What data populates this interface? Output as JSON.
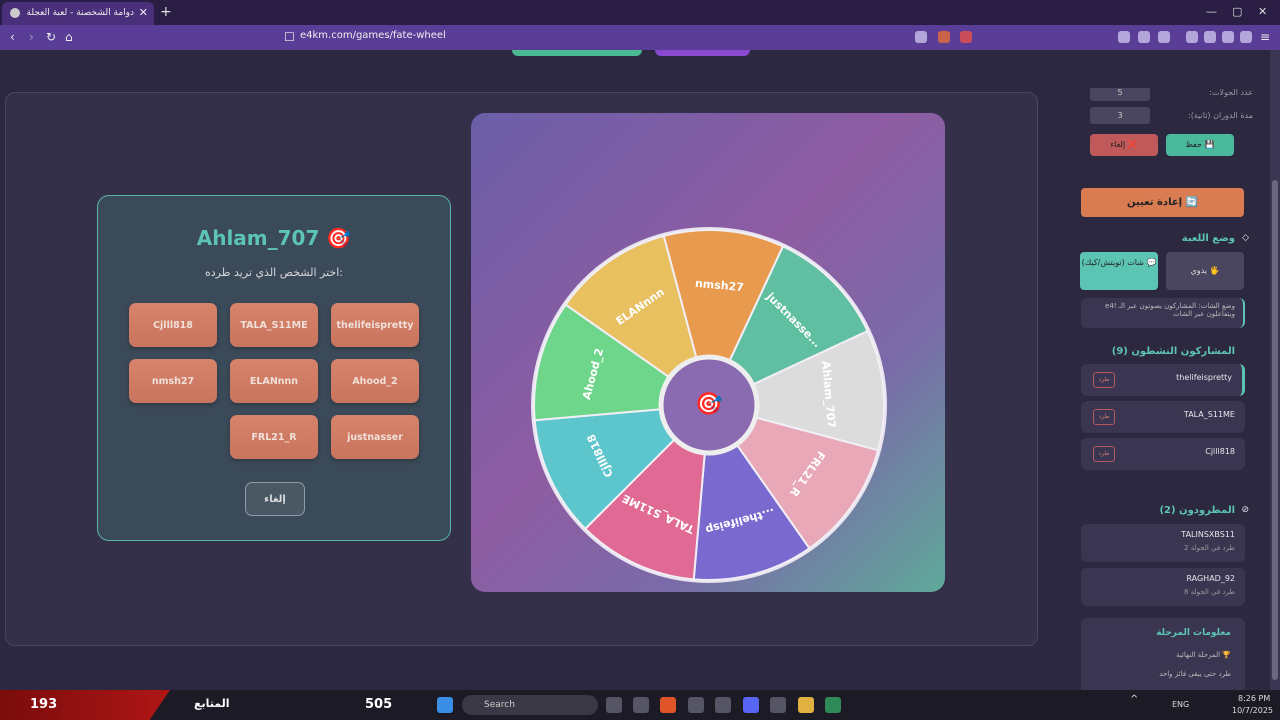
{
  "browser": {
    "tab_title": "دوامة الشخصنة - لعبة العجلة وال...",
    "url": "e4km.com/games/fate-wheel"
  },
  "dialog": {
    "player": "Ahlam_707",
    "title_icon": "🎯",
    "prompt": "اختر الشخص الذي تريد طرده:",
    "players": [
      "Cjlll818",
      "TALA_S11ME",
      "thelifeispretty",
      "nmsh27",
      "ELANnnn",
      "Ahood_2",
      "FRL21_R",
      "justnasser"
    ],
    "cancel": "إلغاء"
  },
  "wheel": {
    "center_icon": "🎯",
    "segments": [
      {
        "label": "nmsh27",
        "color": "#e89a4e"
      },
      {
        "label": "justnasse...",
        "color": "#5fbfa0"
      },
      {
        "label": "Ahlam_707",
        "color": "#dcdcdc"
      },
      {
        "label": "FRL21_R",
        "color": "#e8a8b8"
      },
      {
        "label": "...thelifeisp",
        "color": "#7a6ad0"
      },
      {
        "label": "TALA_S11ME",
        "color": "#e06a94"
      },
      {
        "label": "Cjlll818",
        "color": "#5cc6cc"
      },
      {
        "label": "Ahood_2",
        "color": "#6ed68a"
      },
      {
        "label": "ELANnnn",
        "color": "#e8c060"
      }
    ]
  },
  "sidebar": {
    "rounds_label": "عدد الجولات:",
    "rounds_value": "5",
    "spin_label": "مدة الدوران (ثانية):",
    "spin_value": "3",
    "save": "💾 حفظ",
    "cancel": "❌ إلغاء",
    "reset": "🔄 إعادة تعيين",
    "mode_title": "وضع اللعبة",
    "mode_chat": "💬 شات (تويتش/كيك)",
    "mode_manual": "🖐 يدوي",
    "mode_note": "وضع الشات: المشاركون يصوتون عبر الـ !e4 ويتفاعلون عبر الشات",
    "active_title": "المشاركون النشطون (9)",
    "active": [
      "thelifeispretty",
      "TALA_S11ME",
      "Cjlll818"
    ],
    "kick": "طرد",
    "kicked_title": "المطرودون (2)",
    "kicked": [
      {
        "name": "TALINSXBS11",
        "note": "طرد في الجولة 2"
      },
      {
        "name": "RAGHAD_92",
        "note": "طرد في الجولة 8"
      }
    ],
    "stage_title": "معلومات المرحلة",
    "stage_final": "🏆 المرحلة النهائية",
    "stage_note": "طرد حتى يبقى فائز واحد"
  },
  "taskbar": {
    "left_score": "193",
    "follower_label": "المتابع",
    "center_score": "505",
    "search": "Search",
    "lang": "ENG",
    "time": "8:26 PM",
    "date": "10/7/2025"
  }
}
